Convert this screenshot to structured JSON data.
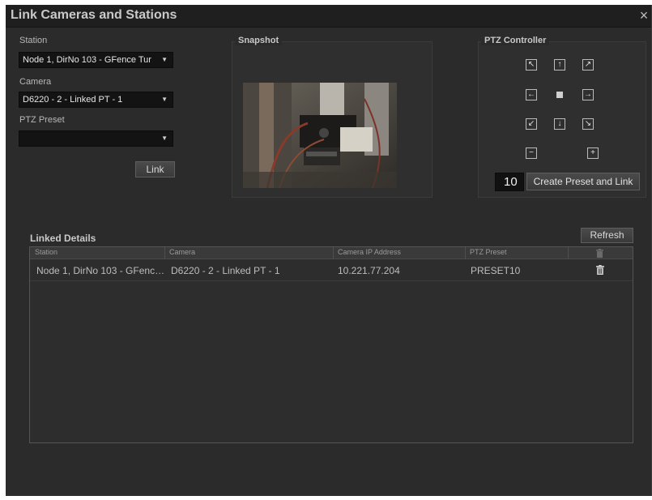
{
  "window": {
    "title": "Link Cameras and Stations",
    "close_glyph": "×"
  },
  "left_form": {
    "station_label": "Station",
    "station_value": "Node 1, DirNo 103 - GFence Tur",
    "camera_label": "Camera",
    "camera_value": "D6220 - 2 - Linked PT - 1",
    "ptz_preset_label": "PTZ Preset",
    "ptz_preset_value": "",
    "link_button": "Link"
  },
  "snapshot": {
    "title": "Snapshot"
  },
  "ptz": {
    "title": "PTZ Controller",
    "buttons": {
      "up_left": "↖",
      "up": "↑",
      "up_right": "↗",
      "left": "←",
      "right": "→",
      "down_left": "↙",
      "down": "↓",
      "down_right": "↘",
      "zoom_out": "−",
      "zoom_in": "+"
    },
    "preset_number": "10",
    "create_preset_button": "Create Preset and Link"
  },
  "linked_details": {
    "title": "Linked Details",
    "refresh_button": "Refresh",
    "columns": [
      "Station",
      "Camera",
      "Camera IP Address",
      "PTZ Preset"
    ],
    "rows": [
      {
        "station": "Node 1, DirNo 103 - GFenc…",
        "camera": "D6220 - 2 - Linked PT - 1",
        "ip": "10.221.77.204",
        "preset": "PRESET10"
      }
    ]
  },
  "icons": {
    "dropdown": "caret-down-icon",
    "delete": "trash-icon",
    "stop": "stop-icon"
  },
  "colors": {
    "dialog_bg": "#2b2b2b",
    "titlebar_bg": "#1f1f1f",
    "field_bg": "#131313",
    "text": "#c9c9c9"
  }
}
